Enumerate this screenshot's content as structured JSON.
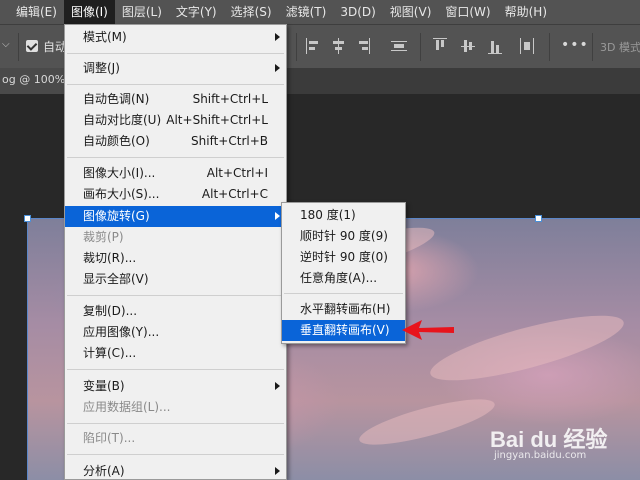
{
  "menubar": {
    "items": [
      "编辑(E)",
      "图像(I)",
      "图层(L)",
      "文字(Y)",
      "选择(S)",
      "滤镜(T)",
      "3D(D)",
      "视图(V)",
      "窗口(W)",
      "帮助(H)"
    ]
  },
  "options_bar": {
    "auto_label": "自动",
    "mode_label": "3D 模式"
  },
  "document_tab": {
    "title": "og @ 100%"
  },
  "image_menu": {
    "items": [
      {
        "label": "模式(M)",
        "shortcut": "",
        "submenu": true,
        "disabled": false
      },
      {
        "label": "调整(J)",
        "shortcut": "",
        "submenu": true,
        "disabled": false
      },
      {
        "label": "自动色调(N)",
        "shortcut": "Shift+Ctrl+L",
        "submenu": false,
        "disabled": false
      },
      {
        "label": "自动对比度(U)",
        "shortcut": "Alt+Shift+Ctrl+L",
        "submenu": false,
        "disabled": false
      },
      {
        "label": "自动颜色(O)",
        "shortcut": "Shift+Ctrl+B",
        "submenu": false,
        "disabled": false
      },
      {
        "label": "图像大小(I)...",
        "shortcut": "Alt+Ctrl+I",
        "submenu": false,
        "disabled": false
      },
      {
        "label": "画布大小(S)...",
        "shortcut": "Alt+Ctrl+C",
        "submenu": false,
        "disabled": false
      },
      {
        "label": "图像旋转(G)",
        "shortcut": "",
        "submenu": true,
        "disabled": false
      },
      {
        "label": "裁剪(P)",
        "shortcut": "",
        "submenu": false,
        "disabled": true
      },
      {
        "label": "裁切(R)...",
        "shortcut": "",
        "submenu": false,
        "disabled": false
      },
      {
        "label": "显示全部(V)",
        "shortcut": "",
        "submenu": false,
        "disabled": false
      },
      {
        "label": "复制(D)...",
        "shortcut": "",
        "submenu": false,
        "disabled": false
      },
      {
        "label": "应用图像(Y)...",
        "shortcut": "",
        "submenu": false,
        "disabled": false
      },
      {
        "label": "计算(C)...",
        "shortcut": "",
        "submenu": false,
        "disabled": false
      },
      {
        "label": "变量(B)",
        "shortcut": "",
        "submenu": true,
        "disabled": false
      },
      {
        "label": "应用数据组(L)...",
        "shortcut": "",
        "submenu": false,
        "disabled": true
      },
      {
        "label": "陷印(T)...",
        "shortcut": "",
        "submenu": false,
        "disabled": true
      },
      {
        "label": "分析(A)",
        "shortcut": "",
        "submenu": true,
        "disabled": false
      }
    ]
  },
  "rotation_submenu": {
    "items": [
      {
        "label": "180 度(1)"
      },
      {
        "label": "顺时针 90 度(9)"
      },
      {
        "label": "逆时针 90 度(0)"
      },
      {
        "label": "任意角度(A)..."
      },
      {
        "label": "水平翻转画布(H)"
      },
      {
        "label": "垂直翻转画布(V)"
      }
    ]
  },
  "watermark": {
    "brand": "Bai du 经验",
    "url": "jingyan.baidu.com"
  },
  "colors": {
    "highlight": "#0a64d8",
    "arrow": "#e8141c"
  }
}
